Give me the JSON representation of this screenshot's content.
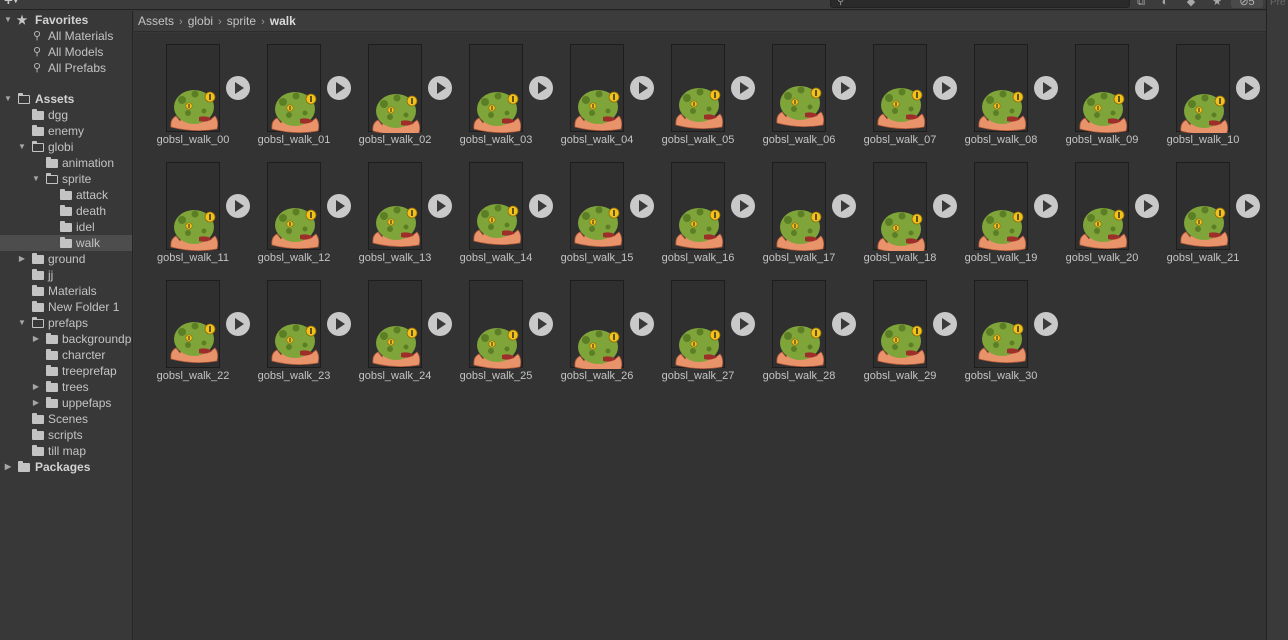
{
  "toolbar": {
    "create_label": "+",
    "search_placeholder": "",
    "hidden_count": "5"
  },
  "right_panel_label": "Pre",
  "sidebar": {
    "favorites": {
      "label": "Favorites",
      "items": [
        "All Materials",
        "All Models",
        "All Prefabs"
      ]
    },
    "assets_label": "Assets",
    "tree": [
      {
        "label": "dgg",
        "depth": 1,
        "arrow": "",
        "selected": false
      },
      {
        "label": "enemy",
        "depth": 1,
        "arrow": "",
        "selected": false
      },
      {
        "label": "globi",
        "depth": 1,
        "arrow": "▼",
        "selected": false
      },
      {
        "label": "animation",
        "depth": 2,
        "arrow": "",
        "selected": false
      },
      {
        "label": "sprite",
        "depth": 2,
        "arrow": "▼",
        "selected": false
      },
      {
        "label": "attack",
        "depth": 3,
        "arrow": "",
        "selected": false
      },
      {
        "label": "death",
        "depth": 3,
        "arrow": "",
        "selected": false
      },
      {
        "label": "idel",
        "depth": 3,
        "arrow": "",
        "selected": false
      },
      {
        "label": "walk",
        "depth": 3,
        "arrow": "",
        "selected": true
      },
      {
        "label": "ground",
        "depth": 1,
        "arrow": "▶",
        "selected": false
      },
      {
        "label": "jj",
        "depth": 1,
        "arrow": "",
        "selected": false
      },
      {
        "label": "Materials",
        "depth": 1,
        "arrow": "",
        "selected": false
      },
      {
        "label": "New Folder 1",
        "depth": 1,
        "arrow": "",
        "selected": false
      },
      {
        "label": "prefaps",
        "depth": 1,
        "arrow": "▼",
        "selected": false
      },
      {
        "label": "backgroundp",
        "depth": 2,
        "arrow": "▶",
        "selected": false
      },
      {
        "label": "charcter",
        "depth": 2,
        "arrow": "",
        "selected": false
      },
      {
        "label": "treeprefap",
        "depth": 2,
        "arrow": "",
        "selected": false
      },
      {
        "label": "trees",
        "depth": 2,
        "arrow": "▶",
        "selected": false
      },
      {
        "label": "uppefaps",
        "depth": 2,
        "arrow": "▶",
        "selected": false
      },
      {
        "label": "Scenes",
        "depth": 1,
        "arrow": "",
        "selected": false
      },
      {
        "label": "scripts",
        "depth": 1,
        "arrow": "",
        "selected": false
      },
      {
        "label": "till map",
        "depth": 1,
        "arrow": "",
        "selected": false
      }
    ],
    "packages_label": "Packages"
  },
  "breadcrumb": [
    "Assets",
    "globi",
    "sprite",
    "walk"
  ],
  "sprites": [
    "gobsl_walk_00",
    "gobsl_walk_01",
    "gobsl_walk_02",
    "gobsl_walk_03",
    "gobsl_walk_04",
    "gobsl_walk_05",
    "gobsl_walk_06",
    "gobsl_walk_07",
    "gobsl_walk_08",
    "gobsl_walk_09",
    "gobsl_walk_10",
    "gobsl_walk_11",
    "gobsl_walk_12",
    "gobsl_walk_13",
    "gobsl_walk_14",
    "gobsl_walk_15",
    "gobsl_walk_16",
    "gobsl_walk_17",
    "gobsl_walk_18",
    "gobsl_walk_19",
    "gobsl_walk_20",
    "gobsl_walk_21",
    "gobsl_walk_22",
    "gobsl_walk_23",
    "gobsl_walk_24",
    "gobsl_walk_25",
    "gobsl_walk_26",
    "gobsl_walk_27",
    "gobsl_walk_28",
    "gobsl_walk_29",
    "gobsl_walk_30"
  ],
  "colors": {
    "frog_body": "#7fa53a",
    "frog_spots": "#5c7f26",
    "frog_eye": "#f2c21a",
    "frog_leaf": "#e8936a"
  }
}
